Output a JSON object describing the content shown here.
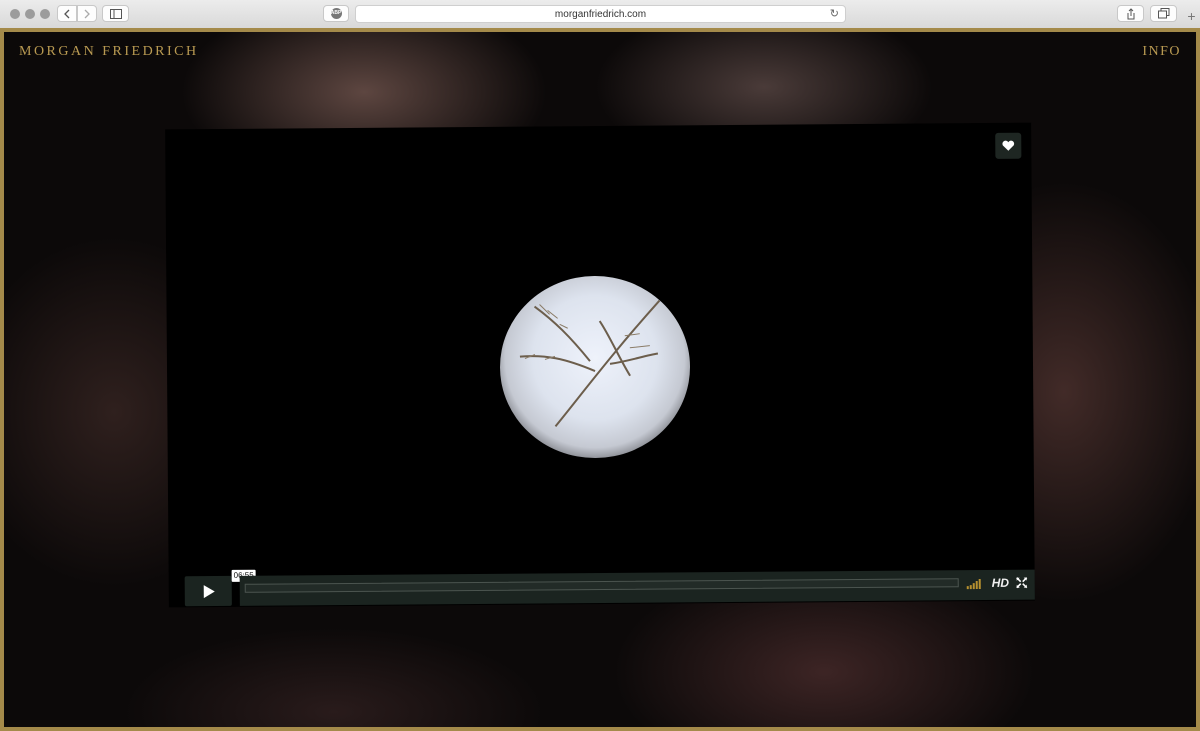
{
  "browser": {
    "url": "morganfriedrich.com",
    "adblock_label": "ABP",
    "new_tab_label": "+"
  },
  "site": {
    "title": "MORGAN FRIEDRICH",
    "info_link": "INFO"
  },
  "player": {
    "timecode": "06:55",
    "hd_label": "HD",
    "progress": 0.0
  },
  "colors": {
    "accent_gold": "#b99a52",
    "frame_border": "#a48a4a",
    "volume_bars": "#b8912f"
  },
  "icons": [
    "back-icon",
    "forward-icon",
    "sidebar-icon",
    "reload-icon",
    "share-icon",
    "tabs-icon",
    "heart-icon",
    "play-icon",
    "volume-icon",
    "fullscreen-icon"
  ]
}
